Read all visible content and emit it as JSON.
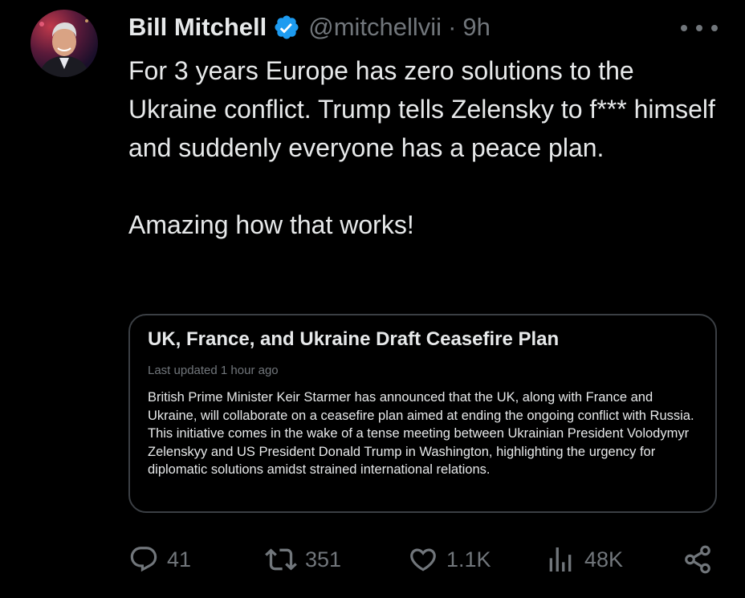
{
  "author": {
    "display_name": "Bill Mitchell",
    "handle": "@mitchellvii",
    "separator": "·",
    "time": "9h",
    "verified": true,
    "verified_color": "#1d9bf0",
    "avatar_icon": "avatar-photo"
  },
  "tweet": {
    "paragraph_1": "For 3 years Europe has zero solutions to the Ukraine conflict.  Trump tells Zelensky to f*** himself and suddenly everyone has a peace plan.",
    "paragraph_2": "Amazing how that works!"
  },
  "card": {
    "title": "UK, France, and Ukraine Draft Ceasefire Plan",
    "updated": "Last updated 1 hour ago",
    "body": "British Prime Minister Keir Starmer has announced that the UK, along with France and Ukraine, will collaborate on a ceasefire plan aimed at ending the ongoing conflict with Russia. This initiative comes in the wake of a tense meeting between Ukrainian President Volodymyr Zelenskyy and US President Donald Trump in Washington, highlighting the urgency for diplomatic solutions amidst strained international relations."
  },
  "actions": {
    "reply_count": "41",
    "retweet_count": "351",
    "like_count": "1.1K",
    "views_count": "48K",
    "icons": [
      "reply-icon",
      "retweet-icon",
      "like-icon",
      "views-icon",
      "share-icon"
    ]
  },
  "colors": {
    "background": "#000000",
    "text": "#e7e9ea",
    "muted": "#71767b",
    "card_border": "#3b3f44"
  }
}
